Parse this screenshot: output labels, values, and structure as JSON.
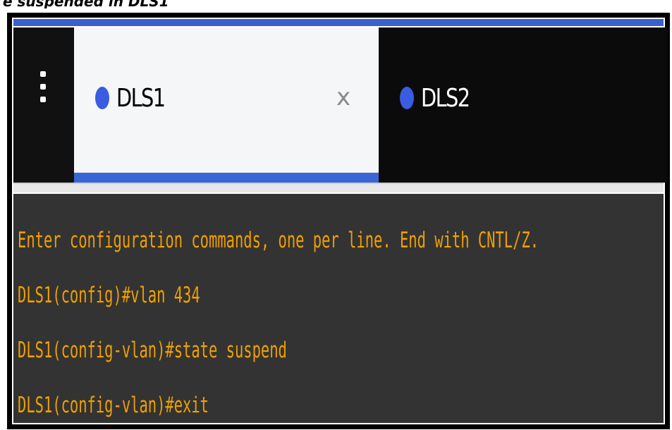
{
  "caption": {
    "text": "e suspended in DLS1"
  },
  "tabs": [
    {
      "label": "DLS1",
      "active": true,
      "status_color": "#3a5ce0",
      "close_label": "x"
    },
    {
      "label": "DLS2",
      "active": false,
      "status_color": "#3a5ce0"
    }
  ],
  "menu": {
    "icon": "kebab-menu-icon"
  },
  "terminal": {
    "text_color": "#f0a000",
    "background": "#333333",
    "lines": [
      "Enter configuration commands, one per line.  End with CNTL/Z.",
      "DLS1(config)#vlan 434",
      "DLS1(config-vlan)#state suspend",
      "DLS1(config-vlan)#exit"
    ]
  }
}
